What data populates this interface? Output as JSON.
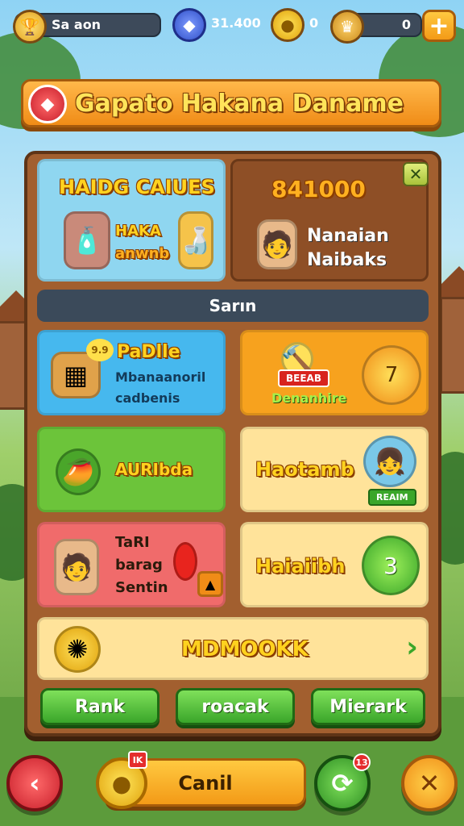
{
  "top_bar": {
    "player_name": "Sa aon",
    "gems_value": "31.400",
    "coins_value": "0",
    "stars_value": "0"
  },
  "title": "Gapato Hakana Daname",
  "panel": {
    "header_card": {
      "title": "HAIDG CAIUES",
      "item_label_line1": "HAKA",
      "item_label_line2": "anwnb"
    },
    "score_card": {
      "value": "841000",
      "name_line1": "Nanaian",
      "name_line2": "Naibaks"
    },
    "section_label": "Sarın",
    "cards": [
      {
        "title": "PaDlle",
        "subtitle_line1": "Mbanaanoril",
        "subtitle_line2": "cadbenis",
        "chip": "9.9"
      },
      {
        "ribbon": "BEEAB",
        "title": "Denanhire",
        "badge_glyph": "7"
      },
      {
        "title": "AURIbda"
      },
      {
        "title": "Haotamb",
        "ribbon": "REAIM"
      },
      {
        "title_line1": "TaRI",
        "title_line2": "barag",
        "title_line3": "Sentin"
      },
      {
        "title": "Haiaiibh",
        "badge_number": "3"
      }
    ],
    "wide_card": {
      "title": "MDMOOKK",
      "arrow": "›"
    },
    "buttons": [
      "Rank",
      "roacak",
      "Mierark"
    ]
  },
  "bottom_nav": {
    "back_glyph": "‹",
    "main_button_label": "Canil",
    "coin_badge": "IK",
    "refresh_badge": "13",
    "close_glyph": "✕"
  },
  "colors": {
    "panel_brown": "#a25f2f",
    "accent_orange": "#f08c17",
    "title_yellow": "#ffe45a",
    "card_blue": "#46b8ee",
    "card_orange": "#f7a21e",
    "card_green": "#6cc43a",
    "card_cream": "#ffe39a",
    "card_red": "#f06b6b"
  },
  "icons": {
    "player": "trophy-icon",
    "gems": "blue-gem-icon",
    "coins": "gold-coin-icon",
    "stars": "lion-medal-icon",
    "add": "plus-icon",
    "title": "red-gem-icon"
  }
}
